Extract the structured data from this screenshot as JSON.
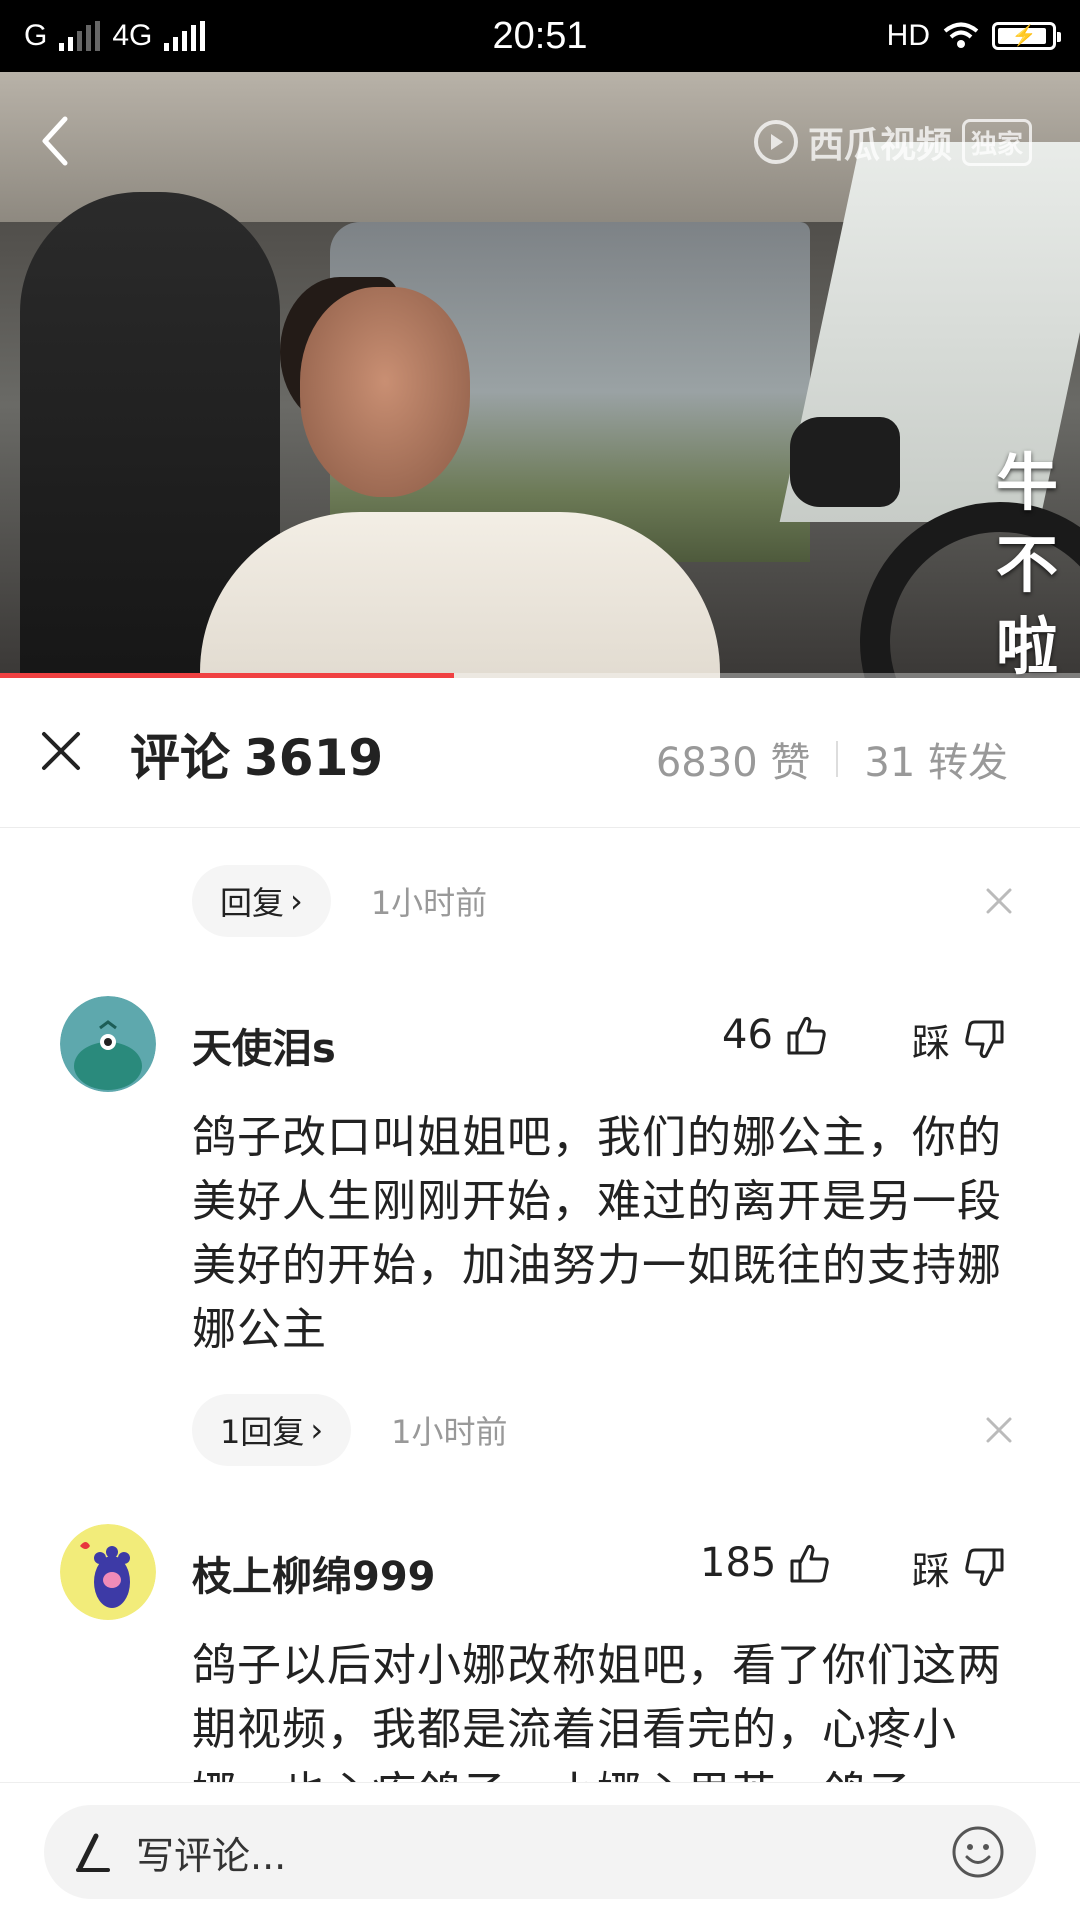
{
  "status_bar": {
    "carrier1": "G",
    "carrier2": "4G",
    "time": "20:51",
    "hd": "HD"
  },
  "video": {
    "watermark_brand": "西瓜视频",
    "watermark_badge": "独家",
    "vertical_caption": [
      "牛",
      "不",
      "啦"
    ],
    "progress": 0.42
  },
  "comments_header": {
    "title": "评论",
    "count": "3619",
    "likes": "6830 赞",
    "shares": "31 转发"
  },
  "top_reply_row": {
    "reply_label": "回复",
    "time": "1小时前"
  },
  "comments": [
    {
      "username": "天使泪s",
      "likes": "46",
      "dislike_label": "踩",
      "text": "鸽子改口叫姐姐吧，我们的娜公主，你的美好人生刚刚开始，难过的离开是另一段美好的开始，加油努力一如既往的支持娜娜公主",
      "reply_label": "1回复",
      "time": "1小时前",
      "avatar_color": "#5ea8ad"
    },
    {
      "username": "枝上柳绵999",
      "likes": "185",
      "dislike_label": "踩",
      "text": "鸽子以后对小娜改称姐吧，看了你们这两期视频，我都是流着泪看完的，心疼小娜，也心疼鸽子，小娜心里苦，鸽子",
      "avatar_color": "#f2ec7a"
    }
  ],
  "input": {
    "placeholder": "写评论..."
  },
  "colors": {
    "accent_red": "#f04142",
    "muted_text": "#999999"
  }
}
